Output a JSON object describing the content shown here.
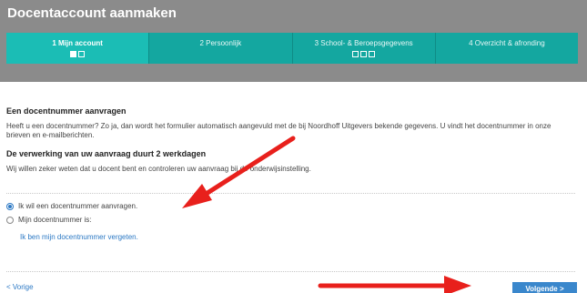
{
  "header": {
    "title": "Docentaccount aanmaken"
  },
  "steps": [
    {
      "label": "1 Mijn account",
      "active": true,
      "dots": [
        "filled",
        "empty"
      ]
    },
    {
      "label": "2 Persoonlijk",
      "active": false,
      "dots": []
    },
    {
      "label": "3 School- & Beroepsgegevens",
      "active": false,
      "dots": [
        "empty",
        "empty",
        "empty"
      ]
    },
    {
      "label": "4 Overzicht & afronding",
      "active": false,
      "dots": []
    }
  ],
  "section": {
    "heading": "Een docentnummer aanvragen",
    "intro": "Heeft u een docentnummer? Zo ja, dan wordt het formulier automatisch aangevuld met de bij Noordhoff Uitgevers bekende gegevens. U vindt het docentnummer in onze brieven en e-mailberichten.",
    "subheading": "De verwerking van uw aanvraag duurt 2 werkdagen",
    "note": "Wij willen zeker weten dat u docent bent en controleren uw aanvraag bij de onderwijsinstelling."
  },
  "options": {
    "request": {
      "label": "Ik wil een docentnummer aanvragen.",
      "checked": true
    },
    "have_number": {
      "label": "Mijn docentnummer is:",
      "checked": false
    },
    "forgot_link": "Ik ben mijn docentnummer vergeten."
  },
  "footer": {
    "prev_label": "< Vorige",
    "next_label": "Volgende  >"
  },
  "colors": {
    "header_bg": "#8b8b8b",
    "step_teal": "#14a7a0",
    "link_blue": "#2b78c4",
    "button_blue": "#3a87cc",
    "annotation_arrow": "#e8201c"
  }
}
